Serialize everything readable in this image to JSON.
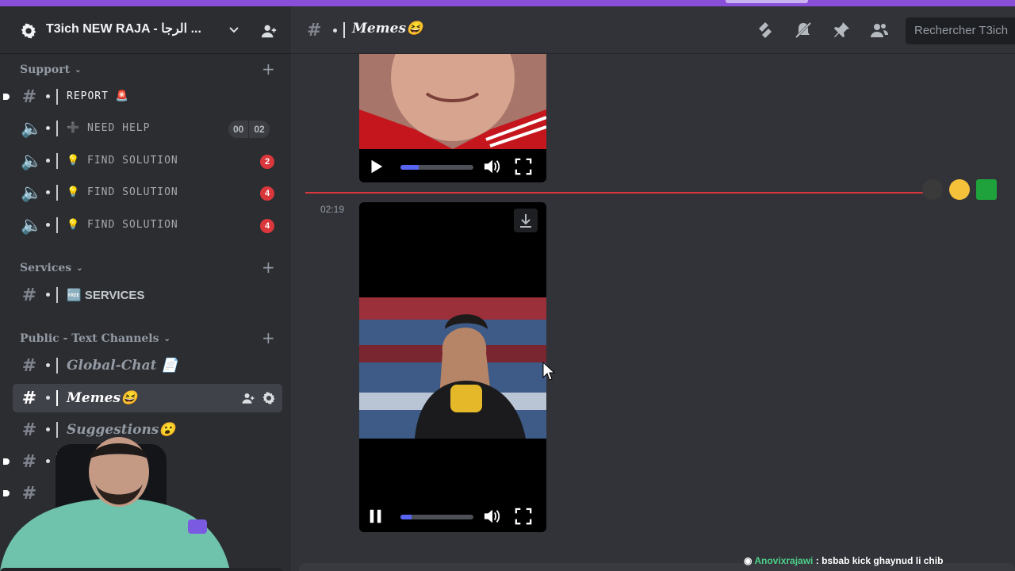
{
  "server": {
    "name": "T3ich NEW RAJA - الرجا ..."
  },
  "categories": {
    "support": "Support",
    "services": "Services",
    "public": "Public - Text Channels"
  },
  "channels": {
    "report": "REPORT 🚨",
    "need_help": "➕ NEED HELP",
    "find_solution_1": "💡 FIND SOLUTION",
    "find_solution_2": "💡 FIND SOLUTION",
    "find_solution_3": "💡 FIND SOLUTION",
    "services": "🆓 SERVICES",
    "global_chat": "Global-Chat 📄",
    "memes": "Memes😆",
    "suggestions": "Suggestions😮"
  },
  "badges": {
    "need_help_left": "00",
    "need_help_right": "02",
    "find_solution_1": "2",
    "find_solution_2": "4",
    "find_solution_3": "4"
  },
  "header": {
    "channel_title": "Memes😆",
    "search_placeholder": "Rechercher T3ich"
  },
  "messages": {
    "timestamp": "02:19"
  },
  "video_progress": {
    "video1": 0.25,
    "video2": 0.15
  },
  "stream_overlay": {
    "user": "Anovixrajawi",
    "text": ": bsbab kick ghaynud li chib"
  },
  "colors": {
    "accent": "#5865f2",
    "topbar": "#8a4fd8",
    "badge_red": "#da373c",
    "new_divider": "#da373c"
  }
}
